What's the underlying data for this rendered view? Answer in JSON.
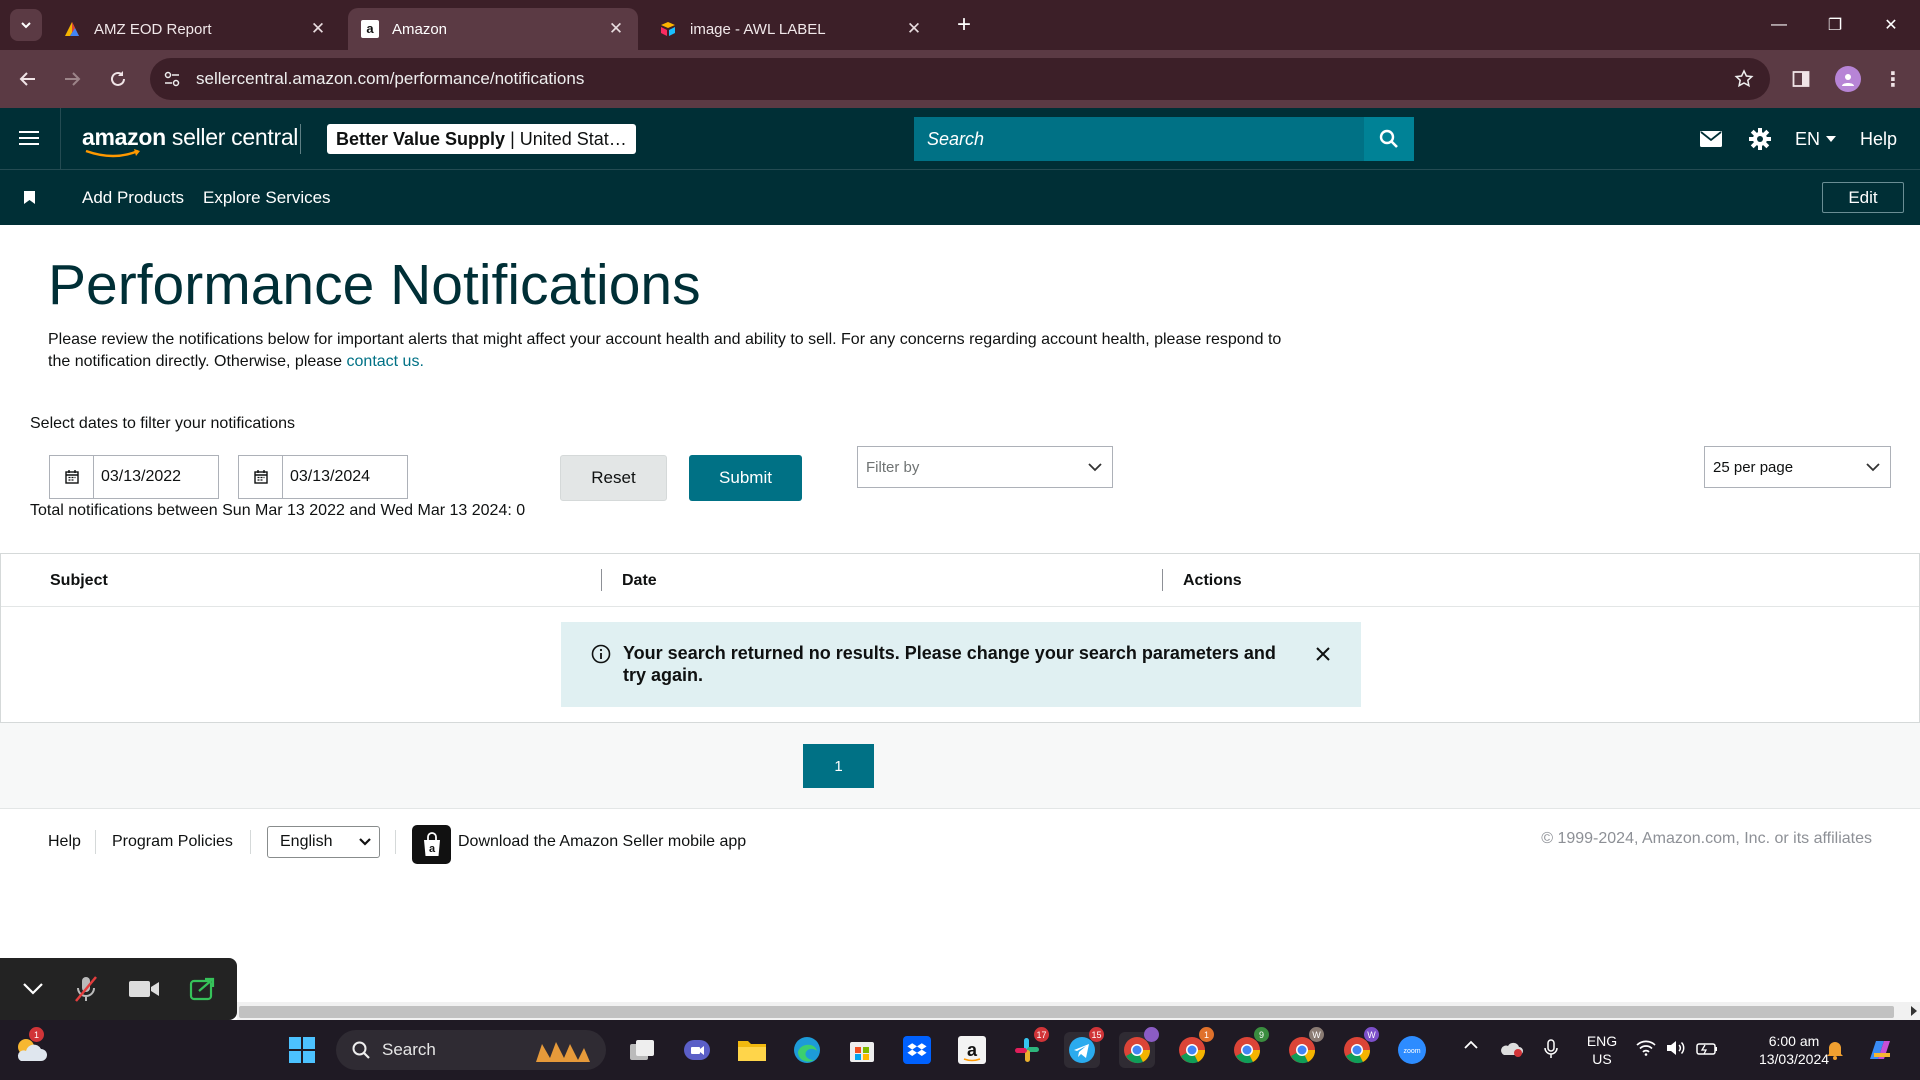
{
  "browser": {
    "tabs": [
      {
        "title": "AMZ EOD Report",
        "icon": "sheets-icon"
      },
      {
        "title": "Amazon",
        "icon": "amazon-icon",
        "active": true
      },
      {
        "title": "image - AWL LABEL",
        "icon": "airtable-icon"
      }
    ],
    "url": "sellercentral.amazon.com/performance/notifications"
  },
  "header": {
    "logo_bold": "amazon",
    "logo_rest": " seller central",
    "store_name": "Better Value Supply",
    "store_region": "United Stat…",
    "search_placeholder": "Search",
    "language": "EN",
    "help": "Help"
  },
  "nav": {
    "add_products": "Add Products",
    "explore_services": "Explore Services",
    "edit": "Edit"
  },
  "page": {
    "title": "Performance Notifications",
    "description": "Please review the notifications below for important alerts that might affect your account health and ability to sell. For any concerns regarding account health, please respond to the notification directly. Otherwise, please ",
    "contact_link": "contact us.",
    "filter_label": "Select dates to filter your notifications",
    "date_from": "03/13/2022",
    "date_to": "03/13/2024",
    "reset": "Reset",
    "submit": "Submit",
    "filter_by": "Filter by",
    "per_page": "25 per page",
    "total_text": "Total notifications between Sun Mar 13 2022 and Wed Mar 13 2024: 0"
  },
  "table": {
    "columns": [
      "Subject",
      "Date",
      "Actions"
    ],
    "no_results": "Your search returned no results. Please change your search parameters and try again."
  },
  "pagination": {
    "current": "1"
  },
  "footer": {
    "help": "Help",
    "program_policies": "Program Policies",
    "language": "English",
    "app_text": "Download the Amazon Seller mobile app",
    "copyright": "© 1999-2024, Amazon.com, Inc. or its affiliates"
  },
  "taskbar": {
    "search": "Search",
    "lang_line1": "ENG",
    "lang_line2": "US",
    "time": "6:00 am",
    "date": "13/03/2024",
    "badges": {
      "weather": "1",
      "slack": "17",
      "telegram": "15",
      "chrome2": "1",
      "chrome3": "9",
      "chrome4": "W",
      "chrome5": "W"
    }
  },
  "colors": {
    "header_bg": "#002f36",
    "teal": "#007185",
    "tab_bar": "#3c1f28"
  }
}
